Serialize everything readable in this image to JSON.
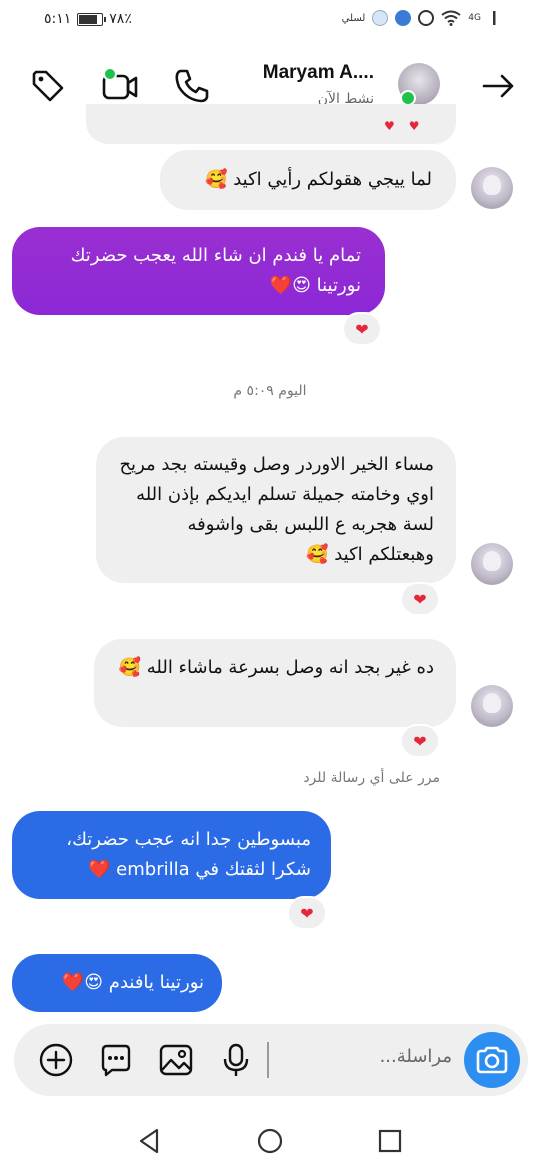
{
  "status_bar": {
    "time": "٥:١١",
    "battery_text": "٧٨٪",
    "battery_level": 0.78,
    "carrier": "لسلي",
    "network": "4G"
  },
  "header": {
    "user_name": "Maryam A....",
    "user_status": "نشط الآن"
  },
  "messages": [
    {
      "text": "لما ييجي هقولكم رأيي اكيد",
      "emoji": "🥰",
      "reaction": "❤"
    },
    {
      "text": "تمام يا فندم ان شاء الله يعجب حضرتك نورتينا",
      "emoji": "😍❤️",
      "reaction": "❤"
    },
    {
      "text": "مساء الخير الاوردر وصل وقيسته بجد مريح اوي وخامته جميلة تسلم ايديكم بإذن الله لسة هجربه ع اللبس بقى واشوفه وهبعتلكم اكيد",
      "emoji": "🥰",
      "reaction": "❤"
    },
    {
      "text": "ده غير بجد انه وصل بسرعة ماشاء الله",
      "emoji": "🥰",
      "reaction": "❤"
    },
    {
      "text": "مبسوطين جدا انه عجب حضرتك، شكرا لثقتك في embrilla",
      "emoji": "❤️",
      "reaction": "❤"
    },
    {
      "text": "نورتينا يافندم",
      "emoji": "😍❤️"
    }
  ],
  "timestamp": "اليوم ٥:٠٩ م",
  "seen_note": "مرر على أي رسالة للرد",
  "composer": {
    "placeholder": "مراسلة..."
  },
  "colors": {
    "purple_bubble": "#8b28d6",
    "blue_bubble": "#2b6be6",
    "incoming_bubble": "#efefef",
    "camera_button": "#2d8ef2",
    "online": "#1fc24b",
    "reaction_heart": "#e3283a"
  },
  "icons": {
    "header": [
      "tag-icon",
      "video-call-icon",
      "phone-icon",
      "back-arrow-icon"
    ],
    "composer": [
      "add-icon",
      "chat-bubble-icon",
      "gallery-icon",
      "microphone-icon",
      "camera-icon"
    ],
    "nav": [
      "nav-back-icon",
      "nav-home-icon",
      "nav-recents-icon"
    ]
  }
}
